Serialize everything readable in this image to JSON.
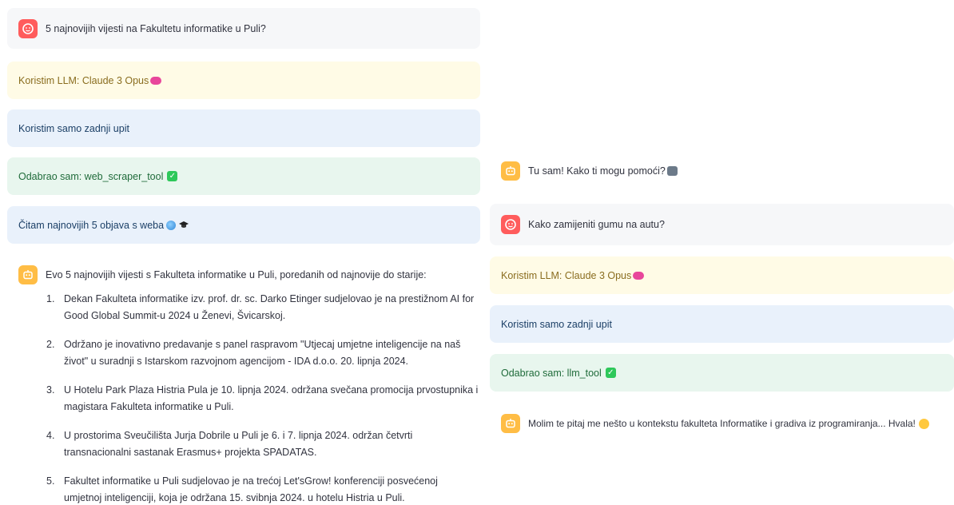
{
  "left": {
    "user_question": "5 najnovijih vijesti na Fakultetu informatike u Puli?",
    "status_llm": "Koristim LLM: Claude 3 Opus",
    "status_query": "Koristim samo zadnji upit",
    "status_tool": "Odabrao sam: web_scraper_tool",
    "status_read": "Čitam najnovijih 5 objava s weba",
    "answer_intro": "Evo 5 najnovijih vijesti s Fakulteta informatike u Puli, poredanih od najnovije do starije:",
    "news": [
      {
        "num": "1.",
        "line1": "Dekan Fakulteta informatike izv. prof. dr. sc. Darko Etinger sudjelovao je na prestižnom AI for",
        "line2": "Good Global Summit-u 2024 u Ženevi, Švicarskoj."
      },
      {
        "num": "2.",
        "line1": "Održano je inovativno predavanje s panel raspravom \"Utjecaj umjetne inteligencije na naš",
        "line2": "život\" u suradnji s Istarskom razvojnom agencijom - IDA d.o.o. 20. lipnja 2024."
      },
      {
        "num": "3.",
        "line1": "U Hotelu Park Plaza Histria Pula je 10. lipnja 2024. održana svečana promocija prvostupnika i",
        "line2": "magistara Fakulteta informatike u Puli."
      },
      {
        "num": "4.",
        "line1": "U prostorima Sveučilišta Jurja Dobrile u Puli je 6. i 7. lipnja 2024. održan četvrti",
        "line2": "transnacionalni sastanak Erasmus+ projekta SPADATAS."
      },
      {
        "num": "5.",
        "line1": "Fakultet informatike u Puli sudjelovao je na trećoj Let'sGrow! konferenciji posvećenoj",
        "line2": "umjetnoj inteligenciji, koja je održana 15. svibnja 2024. u hotelu Histria u Puli."
      }
    ]
  },
  "right": {
    "bot_greeting": "Tu sam! Kako ti mogu pomoći?",
    "user_question": "Kako zamijeniti gumu na autu?",
    "status_llm": "Koristim LLM: Claude 3 Opus",
    "status_query": "Koristim samo zadnji upit",
    "status_tool": "Odabrao sam: llm_tool",
    "bot_answer": "Molim te pitaj me nešto u kontekstu fakulteta Informatike i gradiva iz programiranja... Hvala!"
  },
  "icons": {
    "user_avatar": "user-face-icon",
    "bot_avatar": "robot-face-icon",
    "brain": "brain-emoji-icon",
    "check": "check-mark-emoji-icon",
    "globe": "globe-emoji-icon",
    "cap": "graduation-cap-emoji-icon",
    "robot": "robot-emoji-icon",
    "smile": "smile-emoji-icon"
  },
  "colors": {
    "user_avatar": "#ff5c5c",
    "bot_avatar": "#ffbd45",
    "info_yellow": "#fffbe6",
    "info_blue": "#e9f1fb",
    "success_green": "#e8f6ee"
  }
}
